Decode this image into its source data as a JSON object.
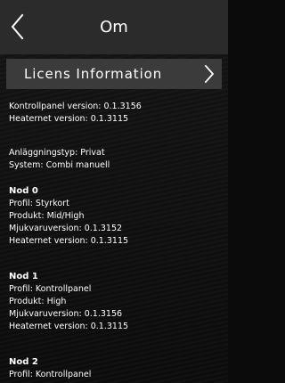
{
  "header": {
    "title": "Om"
  },
  "license_button": {
    "label": "Licens Information"
  },
  "versions": {
    "kontrollpanel": "Kontrollpanel version: 0.1.3156",
    "heaternet": "Heaternet version: 0.1.3115"
  },
  "system": {
    "anlaggningstyp": "Anläggningstyp: Privat",
    "system": "System: Combi manuell"
  },
  "nodes": [
    {
      "title": "Nod 0",
      "profil": "Profil: Styrkort",
      "produkt": "Produkt: Mid/High",
      "mjukvaruversion": "Mjukvaruversion: 0.1.3152",
      "heaternet": "Heaternet version: 0.1.3115"
    },
    {
      "title": "Nod 1",
      "profil": "Profil: Kontrollpanel",
      "produkt": "Produkt: High",
      "mjukvaruversion": "Mjukvaruversion: 0.1.3156",
      "heaternet": "Heaternet version: 0.1.3115"
    },
    {
      "title": "Nod 2",
      "profil": "Profil: Kontrollpanel"
    }
  ],
  "icons": {
    "back": "chevron-left-icon",
    "license": "chevron-right-icon"
  },
  "colors": {
    "header_bg": "#2b2b2b",
    "button_bg": "#3b3b3b",
    "page_bg": "#0c0c0c",
    "text": "#ffffff"
  }
}
